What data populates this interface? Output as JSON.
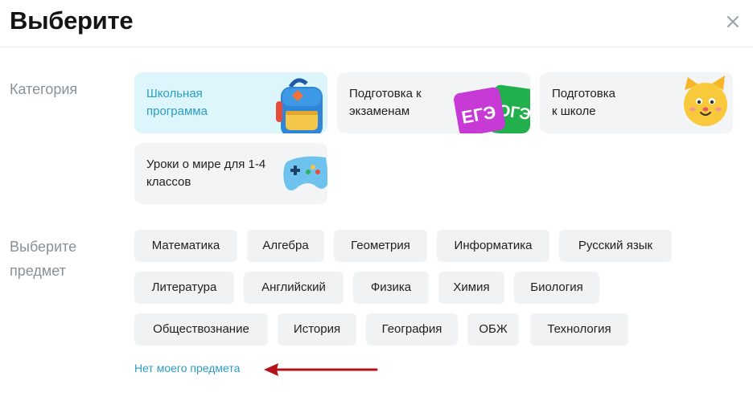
{
  "dialog": {
    "title": "Выберите"
  },
  "category": {
    "label": "Категория",
    "cards": [
      {
        "line1": "Школьная",
        "line2": "программа",
        "active": true
      },
      {
        "line1": "Подготовка к",
        "line2": "экзаменам",
        "active": false
      },
      {
        "line1": "Подготовка",
        "line2": "к школе",
        "active": false
      },
      {
        "line1": "Уроки о мире для 1-4",
        "line2": "классов",
        "active": false
      }
    ],
    "exam_badges": [
      "ЕГЭ",
      "ОГЭ"
    ]
  },
  "subject": {
    "label_line1": "Выберите",
    "label_line2": "предмет",
    "items": [
      "Математика",
      "Алгебра",
      "Геометрия",
      "Информатика",
      "Русский язык",
      "Литература",
      "Английский",
      "Физика",
      "Химия",
      "Биология",
      "Обществознание",
      "История",
      "География",
      "ОБЖ",
      "Технология"
    ]
  },
  "no_subject_link": "Нет моего предмета",
  "colors": {
    "accent": "#2b9ec4",
    "active_card_bg": "#dcf6fb",
    "chip_bg": "#f1f2f4",
    "annotation_arrow": "#b3121a"
  }
}
